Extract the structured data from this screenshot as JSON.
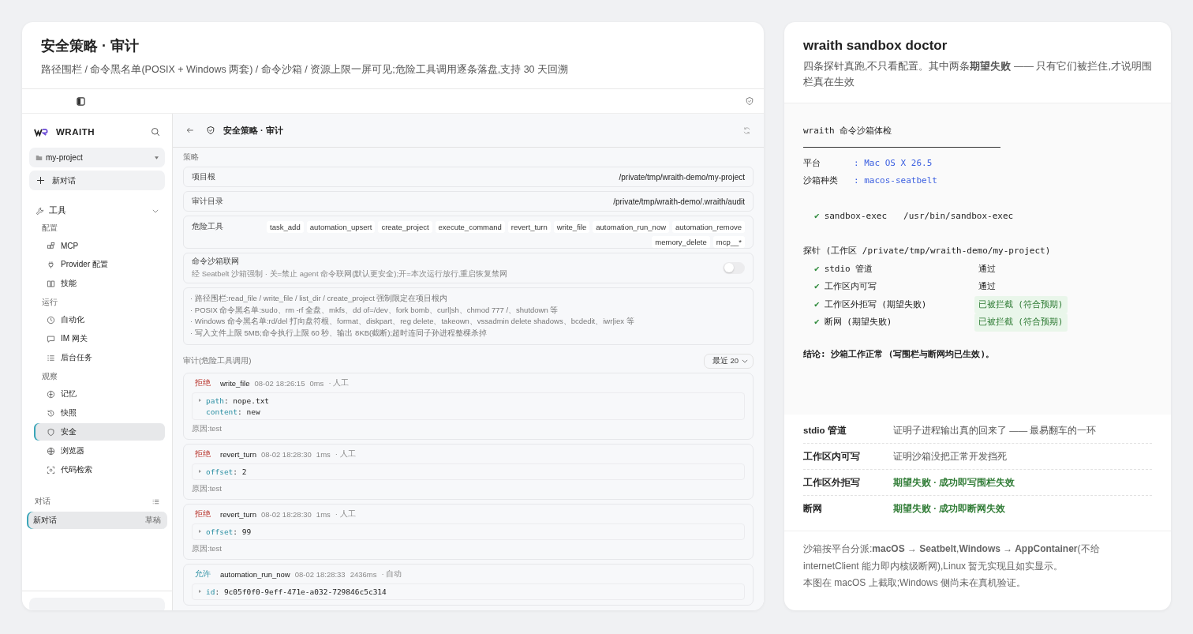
{
  "left_panel": {
    "title": "安全策略 · 审计",
    "subtitle": "路径围栏 / 命令黑名单(POSIX + Windows 两套) / 命令沙箱 / 资源上限一屏可见;危险工具调用逐条落盘,支持 30 天回溯"
  },
  "sidebar": {
    "brand": "WRAITH",
    "project": "my-project",
    "new_chat": "新对话",
    "tools": {
      "label": "工具",
      "expanded": true
    },
    "sections": [
      {
        "label": "配置",
        "items": [
          {
            "label": "MCP",
            "selected": false
          },
          {
            "label": "Provider 配置",
            "selected": false
          },
          {
            "label": "技能",
            "selected": false
          }
        ]
      },
      {
        "label": "运行",
        "items": [
          {
            "label": "自动化",
            "selected": false
          },
          {
            "label": "IM 网关",
            "selected": false
          },
          {
            "label": "后台任务",
            "selected": false
          }
        ]
      },
      {
        "label": "观察",
        "items": [
          {
            "label": "记忆",
            "selected": false
          },
          {
            "label": "快照",
            "selected": false
          },
          {
            "label": "安全",
            "selected": true
          },
          {
            "label": "浏览器",
            "selected": false
          },
          {
            "label": "代码检索",
            "selected": false
          }
        ]
      }
    ],
    "conversations": {
      "label": "对话",
      "items": [
        {
          "title": "新对话",
          "badge": "草稿",
          "selected": true
        }
      ]
    }
  },
  "page": {
    "title": "安全策略 · 审计",
    "policy_label": "策略",
    "fields": [
      {
        "label": "项目根",
        "value": "/private/tmp/wraith-demo/my-project"
      },
      {
        "label": "审计目录",
        "value": "/private/tmp/wraith-demo/.wraith/audit"
      }
    ],
    "dangerous_tools": {
      "label": "危险工具",
      "tags": [
        "task_add",
        "automation_upsert",
        "create_project",
        "execute_command",
        "revert_turn",
        "write_file",
        "automation_run_now",
        "automation_remove",
        "memory_delete",
        "mcp__*"
      ]
    },
    "network": {
      "title": "命令沙箱联网",
      "description": "经 Seatbelt 沙箱强制 · 关=禁止 agent 命令联网(默认更安全);开=本次运行放行,重启恢复禁网",
      "on": false
    },
    "notes": [
      "· 路径围栏:read_file / write_file / list_dir / create_project 强制限定在项目根内",
      "· POSIX 命令黑名单:sudo、rm -rf 全盘、mkfs、dd of=/dev、fork bomb、curl|sh、chmod 777 /、shutdown 等",
      "· Windows 命令黑名单:rd/del 打向盘符根、format、diskpart、reg delete、takeown、vssadmin delete shadows、bcdedit、iwr|iex 等",
      "· 写入文件上限 5MB;命令执行上限 60 秒、输出 8KB(截断);超时连同子孙进程整棵杀掉"
    ],
    "audit": {
      "label": "审计(危险工具调用)",
      "filter": "最近 20",
      "entries": [
        {
          "decision": "拒绝",
          "kind": "deny",
          "tool": "write_file",
          "time": "08-02 18:26:15",
          "duration": "0ms",
          "mode": "· 人工",
          "args": [
            {
              "key": "path",
              "value": ": nope.txt"
            },
            {
              "key": "content",
              "value": ": new"
            }
          ],
          "reason": "原因:test"
        },
        {
          "decision": "拒绝",
          "kind": "deny",
          "tool": "revert_turn",
          "time": "08-02 18:28:30",
          "duration": "1ms",
          "mode": "· 人工",
          "args": [
            {
              "key": "offset",
              "value": ": 2"
            }
          ],
          "reason": "原因:test"
        },
        {
          "decision": "拒绝",
          "kind": "deny",
          "tool": "revert_turn",
          "time": "08-02 18:28:30",
          "duration": "1ms",
          "mode": "· 人工",
          "args": [
            {
              "key": "offset",
              "value": ": 99"
            }
          ],
          "reason": "原因:test"
        },
        {
          "decision": "允许",
          "kind": "allow",
          "tool": "automation_run_now",
          "time": "08-02 18:28:33",
          "duration": "2436ms",
          "mode": "· 自动",
          "args": [
            {
              "key": "id",
              "value": ": 9c05f0f0-9eff-471e-a032-729846c5c314"
            }
          ]
        }
      ]
    }
  },
  "right_panel": {
    "title": "wraith sandbox doctor",
    "subtitle": "四条探针真跑,不只看配置。其中两条**期望失败** —— 只有它们被拦住,才说明围栏真在生效",
    "terminal": [
      {
        "kind": "heading",
        "text": "wraith 命令沙箱体检"
      },
      {
        "kind": "rule"
      },
      {
        "kind": "kv",
        "key": "平台",
        "value": ": Mac OS X 26.5"
      },
      {
        "kind": "kv",
        "key": "沙箱种类",
        "value": ": macos-seatbelt"
      },
      {
        "kind": "gap"
      },
      {
        "kind": "path",
        "mark": "✔",
        "name": "sandbox-exec",
        "value": "/usr/bin/sandbox-exec"
      },
      {
        "kind": "gap"
      },
      {
        "kind": "heading",
        "text": "探针 (工作区 /private/tmp/wraith-demo/my-project)"
      },
      {
        "kind": "check",
        "mark": "✔",
        "name": "stdio 管道",
        "result": "通过",
        "blocked": false
      },
      {
        "kind": "check",
        "mark": "✔",
        "name": "工作区内可写",
        "result": "通过",
        "blocked": false
      },
      {
        "kind": "check",
        "mark": "✔",
        "name": "工作区外拒写 (期望失败)",
        "result": "已被拦截 (符合预期)",
        "blocked": true
      },
      {
        "kind": "check",
        "mark": "✔",
        "name": "断网 (期望失败)",
        "result": "已被拦截 (符合预期)",
        "blocked": true
      },
      {
        "kind": "gap"
      },
      {
        "kind": "conclusion",
        "text": "结论: 沙箱工作正常 (写围栏与断网均已生效)。"
      }
    ],
    "table": [
      {
        "probe": "stdio 管道",
        "meaning": "证明子进程输出真的回来了 —— 最易翻车的一环",
        "expected_fail": false
      },
      {
        "probe": "工作区内可写",
        "meaning": "证明沙箱没把正常开发挡死",
        "expected_fail": false
      },
      {
        "probe": "工作区外拒写",
        "meaning": "期望失败 · 成功即写围栏失效",
        "expected_fail": true
      },
      {
        "probe": "断网",
        "meaning": "期望失败 · 成功即断网失效",
        "expected_fail": true
      }
    ],
    "footer": [
      "沙箱按平台分派:**macOS → Seatbelt**,**Windows → AppContainer**(不给 internetClient 能力即内核级断网),Linux 暂无实现且如实显示。",
      "本图在 macOS 上截取;Windows 侧尚未在真机验证。"
    ]
  }
}
